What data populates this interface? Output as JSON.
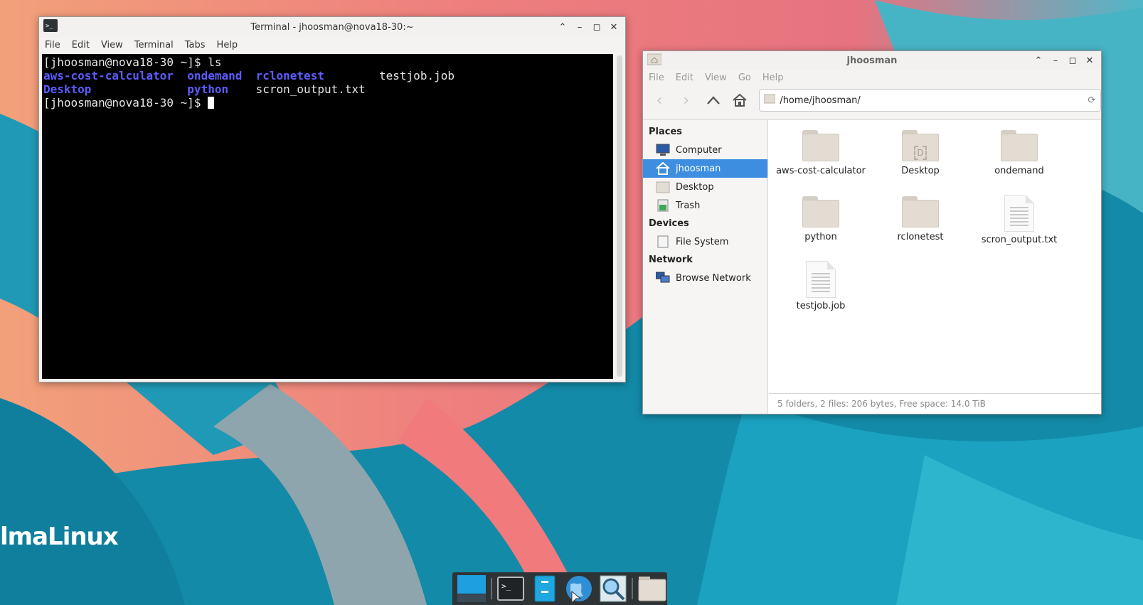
{
  "desktop": {
    "brand": "lmaLinux"
  },
  "terminal": {
    "title": "Terminal - jhoosman@nova18-30:~",
    "menu": [
      "File",
      "Edit",
      "View",
      "Terminal",
      "Tabs",
      "Help"
    ],
    "lines": [
      {
        "prompt": "[jhoosman@nova18-30 ~]$ ",
        "cmd": "ls"
      },
      {
        "cols": [
          {
            "text": "aws-cost-calculator",
            "dir": true
          },
          {
            "text": "ondemand",
            "dir": true
          },
          {
            "text": "rclonetest",
            "dir": true
          },
          {
            "text": "testjob.job",
            "dir": false
          }
        ]
      },
      {
        "cols": [
          {
            "text": "Desktop",
            "dir": true
          },
          {
            "text": "python",
            "dir": true
          },
          {
            "text": "scron_output.txt",
            "dir": false
          }
        ]
      },
      {
        "prompt": "[jhoosman@nova18-30 ~]$ ",
        "cmd": ""
      }
    ]
  },
  "filemanager": {
    "title": "jhoosman",
    "menu": [
      "File",
      "Edit",
      "View",
      "Go",
      "Help"
    ],
    "location": "/home/jhoosman/",
    "sidebar": {
      "places_label": "Places",
      "devices_label": "Devices",
      "network_label": "Network",
      "places": [
        {
          "label": "Computer",
          "icon": "computer-icon"
        },
        {
          "label": "jhoosman",
          "icon": "home-icon",
          "selected": true
        },
        {
          "label": "Desktop",
          "icon": "desktop-folder-icon"
        },
        {
          "label": "Trash",
          "icon": "trash-icon"
        }
      ],
      "devices": [
        {
          "label": "File System",
          "icon": "drive-icon"
        }
      ],
      "network": [
        {
          "label": "Browse Network",
          "icon": "network-icon"
        }
      ]
    },
    "items": [
      {
        "name": "aws-cost-calculator",
        "kind": "folder"
      },
      {
        "name": "Desktop",
        "kind": "desktop-folder"
      },
      {
        "name": "ondemand",
        "kind": "folder"
      },
      {
        "name": "python",
        "kind": "folder"
      },
      {
        "name": "rclonetest",
        "kind": "folder"
      },
      {
        "name": "scron_output.txt",
        "kind": "file"
      },
      {
        "name": "testjob.job",
        "kind": "file"
      }
    ],
    "status": "5 folders, 2 files: 206 bytes, Free space: 14.0 TiB"
  },
  "taskbar": {
    "items": [
      "show-desktop-icon",
      "terminal-icon",
      "file-manager-icon",
      "web-browser-icon",
      "app-finder-icon",
      "home-folder-icon"
    ]
  }
}
